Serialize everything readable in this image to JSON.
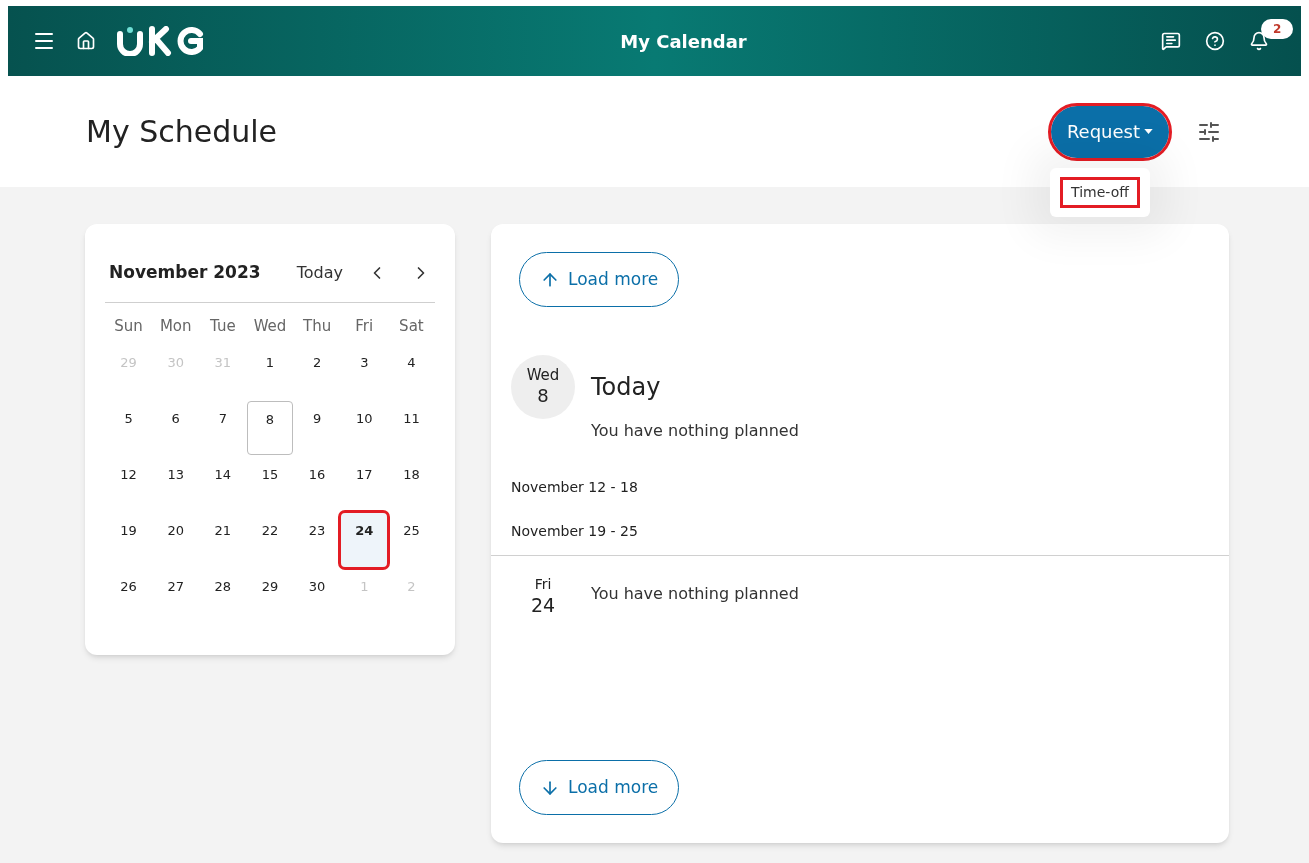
{
  "header": {
    "title": "My Calendar",
    "notification_count": "2"
  },
  "page_title": "My Schedule",
  "request_button": {
    "label": "Request",
    "highlighted": true
  },
  "request_menu": [
    {
      "label": "Time-off",
      "highlighted": true
    }
  ],
  "calendar": {
    "month": "November 2023",
    "today_label": "Today",
    "weekdays": [
      "Sun",
      "Mon",
      "Tue",
      "Wed",
      "Thu",
      "Fri",
      "Sat"
    ],
    "weeks": [
      [
        {
          "label": "29",
          "outside": true,
          "today": false,
          "selected": false,
          "highlighted": false
        },
        {
          "label": "30",
          "outside": true,
          "today": false,
          "selected": false,
          "highlighted": false
        },
        {
          "label": "31",
          "outside": true,
          "today": false,
          "selected": false,
          "highlighted": false
        },
        {
          "label": "1",
          "outside": false,
          "today": false,
          "selected": false,
          "highlighted": false
        },
        {
          "label": "2",
          "outside": false,
          "today": false,
          "selected": false,
          "highlighted": false
        },
        {
          "label": "3",
          "outside": false,
          "today": false,
          "selected": false,
          "highlighted": false
        },
        {
          "label": "4",
          "outside": false,
          "today": false,
          "selected": false,
          "highlighted": false
        }
      ],
      [
        {
          "label": "5",
          "outside": false,
          "today": false,
          "selected": false,
          "highlighted": false
        },
        {
          "label": "6",
          "outside": false,
          "today": false,
          "selected": false,
          "highlighted": false
        },
        {
          "label": "7",
          "outside": false,
          "today": false,
          "selected": false,
          "highlighted": false
        },
        {
          "label": "8",
          "outside": false,
          "today": true,
          "selected": false,
          "highlighted": false
        },
        {
          "label": "9",
          "outside": false,
          "today": false,
          "selected": false,
          "highlighted": false
        },
        {
          "label": "10",
          "outside": false,
          "today": false,
          "selected": false,
          "highlighted": false
        },
        {
          "label": "11",
          "outside": false,
          "today": false,
          "selected": false,
          "highlighted": false
        }
      ],
      [
        {
          "label": "12",
          "outside": false,
          "today": false,
          "selected": false,
          "highlighted": false
        },
        {
          "label": "13",
          "outside": false,
          "today": false,
          "selected": false,
          "highlighted": false
        },
        {
          "label": "14",
          "outside": false,
          "today": false,
          "selected": false,
          "highlighted": false
        },
        {
          "label": "15",
          "outside": false,
          "today": false,
          "selected": false,
          "highlighted": false
        },
        {
          "label": "16",
          "outside": false,
          "today": false,
          "selected": false,
          "highlighted": false
        },
        {
          "label": "17",
          "outside": false,
          "today": false,
          "selected": false,
          "highlighted": false
        },
        {
          "label": "18",
          "outside": false,
          "today": false,
          "selected": false,
          "highlighted": false
        }
      ],
      [
        {
          "label": "19",
          "outside": false,
          "today": false,
          "selected": false,
          "highlighted": false
        },
        {
          "label": "20",
          "outside": false,
          "today": false,
          "selected": false,
          "highlighted": false
        },
        {
          "label": "21",
          "outside": false,
          "today": false,
          "selected": false,
          "highlighted": false
        },
        {
          "label": "22",
          "outside": false,
          "today": false,
          "selected": false,
          "highlighted": false
        },
        {
          "label": "23",
          "outside": false,
          "today": false,
          "selected": false,
          "highlighted": false
        },
        {
          "label": "24",
          "outside": false,
          "today": false,
          "selected": true,
          "highlighted": true
        },
        {
          "label": "25",
          "outside": false,
          "today": false,
          "selected": false,
          "highlighted": false
        }
      ],
      [
        {
          "label": "26",
          "outside": false,
          "today": false,
          "selected": false,
          "highlighted": false
        },
        {
          "label": "27",
          "outside": false,
          "today": false,
          "selected": false,
          "highlighted": false
        },
        {
          "label": "28",
          "outside": false,
          "today": false,
          "selected": false,
          "highlighted": false
        },
        {
          "label": "29",
          "outside": false,
          "today": false,
          "selected": false,
          "highlighted": false
        },
        {
          "label": "30",
          "outside": false,
          "today": false,
          "selected": false,
          "highlighted": false
        },
        {
          "label": "1",
          "outside": true,
          "today": false,
          "selected": false,
          "highlighted": false
        },
        {
          "label": "2",
          "outside": true,
          "today": false,
          "selected": false,
          "highlighted": false
        }
      ]
    ]
  },
  "agenda": {
    "load_more_top": "Load more",
    "load_more_bottom": "Load more",
    "items": [
      {
        "kind": "today",
        "weekday": "Wed",
        "day": "8",
        "heading": "Today",
        "note": "You have nothing planned"
      },
      {
        "kind": "week",
        "label": "November 12 - 18"
      },
      {
        "kind": "week",
        "label": "November 19 - 25"
      },
      {
        "kind": "day",
        "weekday": "Fri",
        "day": "24",
        "note": "You have nothing planned"
      }
    ]
  }
}
